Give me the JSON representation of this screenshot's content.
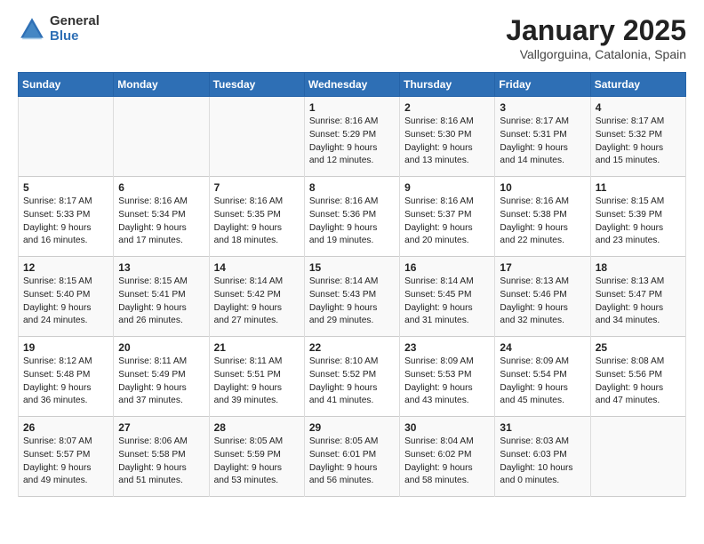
{
  "header": {
    "logo_general": "General",
    "logo_blue": "Blue",
    "month_title": "January 2025",
    "location": "Vallgorguina, Catalonia, Spain"
  },
  "weekdays": [
    "Sunday",
    "Monday",
    "Tuesday",
    "Wednesday",
    "Thursday",
    "Friday",
    "Saturday"
  ],
  "weeks": [
    [
      {
        "day": "",
        "text": ""
      },
      {
        "day": "",
        "text": ""
      },
      {
        "day": "",
        "text": ""
      },
      {
        "day": "1",
        "text": "Sunrise: 8:16 AM\nSunset: 5:29 PM\nDaylight: 9 hours\nand 12 minutes."
      },
      {
        "day": "2",
        "text": "Sunrise: 8:16 AM\nSunset: 5:30 PM\nDaylight: 9 hours\nand 13 minutes."
      },
      {
        "day": "3",
        "text": "Sunrise: 8:17 AM\nSunset: 5:31 PM\nDaylight: 9 hours\nand 14 minutes."
      },
      {
        "day": "4",
        "text": "Sunrise: 8:17 AM\nSunset: 5:32 PM\nDaylight: 9 hours\nand 15 minutes."
      }
    ],
    [
      {
        "day": "5",
        "text": "Sunrise: 8:17 AM\nSunset: 5:33 PM\nDaylight: 9 hours\nand 16 minutes."
      },
      {
        "day": "6",
        "text": "Sunrise: 8:16 AM\nSunset: 5:34 PM\nDaylight: 9 hours\nand 17 minutes."
      },
      {
        "day": "7",
        "text": "Sunrise: 8:16 AM\nSunset: 5:35 PM\nDaylight: 9 hours\nand 18 minutes."
      },
      {
        "day": "8",
        "text": "Sunrise: 8:16 AM\nSunset: 5:36 PM\nDaylight: 9 hours\nand 19 minutes."
      },
      {
        "day": "9",
        "text": "Sunrise: 8:16 AM\nSunset: 5:37 PM\nDaylight: 9 hours\nand 20 minutes."
      },
      {
        "day": "10",
        "text": "Sunrise: 8:16 AM\nSunset: 5:38 PM\nDaylight: 9 hours\nand 22 minutes."
      },
      {
        "day": "11",
        "text": "Sunrise: 8:15 AM\nSunset: 5:39 PM\nDaylight: 9 hours\nand 23 minutes."
      }
    ],
    [
      {
        "day": "12",
        "text": "Sunrise: 8:15 AM\nSunset: 5:40 PM\nDaylight: 9 hours\nand 24 minutes."
      },
      {
        "day": "13",
        "text": "Sunrise: 8:15 AM\nSunset: 5:41 PM\nDaylight: 9 hours\nand 26 minutes."
      },
      {
        "day": "14",
        "text": "Sunrise: 8:14 AM\nSunset: 5:42 PM\nDaylight: 9 hours\nand 27 minutes."
      },
      {
        "day": "15",
        "text": "Sunrise: 8:14 AM\nSunset: 5:43 PM\nDaylight: 9 hours\nand 29 minutes."
      },
      {
        "day": "16",
        "text": "Sunrise: 8:14 AM\nSunset: 5:45 PM\nDaylight: 9 hours\nand 31 minutes."
      },
      {
        "day": "17",
        "text": "Sunrise: 8:13 AM\nSunset: 5:46 PM\nDaylight: 9 hours\nand 32 minutes."
      },
      {
        "day": "18",
        "text": "Sunrise: 8:13 AM\nSunset: 5:47 PM\nDaylight: 9 hours\nand 34 minutes."
      }
    ],
    [
      {
        "day": "19",
        "text": "Sunrise: 8:12 AM\nSunset: 5:48 PM\nDaylight: 9 hours\nand 36 minutes."
      },
      {
        "day": "20",
        "text": "Sunrise: 8:11 AM\nSunset: 5:49 PM\nDaylight: 9 hours\nand 37 minutes."
      },
      {
        "day": "21",
        "text": "Sunrise: 8:11 AM\nSunset: 5:51 PM\nDaylight: 9 hours\nand 39 minutes."
      },
      {
        "day": "22",
        "text": "Sunrise: 8:10 AM\nSunset: 5:52 PM\nDaylight: 9 hours\nand 41 minutes."
      },
      {
        "day": "23",
        "text": "Sunrise: 8:09 AM\nSunset: 5:53 PM\nDaylight: 9 hours\nand 43 minutes."
      },
      {
        "day": "24",
        "text": "Sunrise: 8:09 AM\nSunset: 5:54 PM\nDaylight: 9 hours\nand 45 minutes."
      },
      {
        "day": "25",
        "text": "Sunrise: 8:08 AM\nSunset: 5:56 PM\nDaylight: 9 hours\nand 47 minutes."
      }
    ],
    [
      {
        "day": "26",
        "text": "Sunrise: 8:07 AM\nSunset: 5:57 PM\nDaylight: 9 hours\nand 49 minutes."
      },
      {
        "day": "27",
        "text": "Sunrise: 8:06 AM\nSunset: 5:58 PM\nDaylight: 9 hours\nand 51 minutes."
      },
      {
        "day": "28",
        "text": "Sunrise: 8:05 AM\nSunset: 5:59 PM\nDaylight: 9 hours\nand 53 minutes."
      },
      {
        "day": "29",
        "text": "Sunrise: 8:05 AM\nSunset: 6:01 PM\nDaylight: 9 hours\nand 56 minutes."
      },
      {
        "day": "30",
        "text": "Sunrise: 8:04 AM\nSunset: 6:02 PM\nDaylight: 9 hours\nand 58 minutes."
      },
      {
        "day": "31",
        "text": "Sunrise: 8:03 AM\nSunset: 6:03 PM\nDaylight: 10 hours\nand 0 minutes."
      },
      {
        "day": "",
        "text": ""
      }
    ]
  ]
}
